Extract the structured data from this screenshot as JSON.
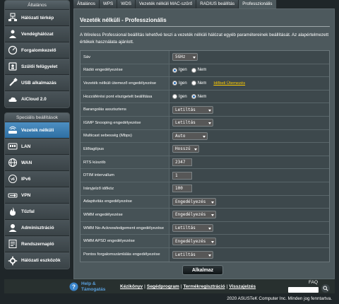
{
  "sidebar": {
    "general_title": "Általános",
    "general_items": [
      {
        "label": "Hálózati térkép",
        "icon": "network-map-icon"
      },
      {
        "label": "Vendéghálózat",
        "icon": "guest-network-icon"
      },
      {
        "label": "Forgalomkezelő",
        "icon": "traffic-manager-icon"
      },
      {
        "label": "Szülői felügyelet",
        "icon": "parental-control-icon"
      },
      {
        "label": "USB alkalmazás",
        "icon": "usb-icon"
      },
      {
        "label": "AiCloud 2.0",
        "icon": "cloud-icon"
      }
    ],
    "advanced_title": "Speciális beállítások",
    "advanced_items": [
      {
        "label": "Vezeték nélküli",
        "icon": "wireless-icon",
        "active": true
      },
      {
        "label": "LAN",
        "icon": "lan-icon"
      },
      {
        "label": "WAN",
        "icon": "wan-icon"
      },
      {
        "label": "IPv6",
        "icon": "ipv6-icon"
      },
      {
        "label": "VPN",
        "icon": "vpn-icon"
      },
      {
        "label": "Tűzfal",
        "icon": "firewall-icon"
      },
      {
        "label": "Adminisztráció",
        "icon": "administration-icon"
      },
      {
        "label": "Rendszernapló",
        "icon": "system-log-icon"
      },
      {
        "label": "Hálózati eszközök",
        "icon": "network-tools-icon"
      }
    ]
  },
  "tabs": [
    "Általános",
    "WPS",
    "WDS",
    "Vezeték nélküli MAC-szűrő",
    "RADIUS beállítás",
    "Professzionális"
  ],
  "active_tab": 5,
  "page": {
    "title": "Vezeték nélküli - Professzionális",
    "description": "A Wireless Professional beállítás lehetővé teszi a vezeték nélküli hálózat egyéb paramétereinek beállítását. Az alapértelmezett értékek használata ajánlott."
  },
  "settings": {
    "band": {
      "label": "Sáv",
      "value": "5GHz"
    },
    "radio_enable": {
      "label": "Rádió engedélyezése",
      "yes": "Igen",
      "no": "Nem",
      "selected": "yes"
    },
    "scheduler": {
      "label": "Vezeték nélküli ütemező engedélyezése",
      "yes": "Igen",
      "no": "Nem",
      "selected": "yes",
      "link": "Időbeli Ütemezés"
    },
    "ap_isolation": {
      "label": "Hozzáférési pont elszigetelt beállítása",
      "yes": "Igen",
      "no": "Nem",
      "selected": "no"
    },
    "roaming": {
      "label": "Barangolás asszisztens",
      "value": "Letiltás"
    },
    "igmp": {
      "label": "IGMP Snooping engedélyezése",
      "value": "Letiltás"
    },
    "multicast": {
      "label": "Multicast sebesség (Mbps)",
      "value": "Auto"
    },
    "preamble": {
      "label": "Előtagtípus",
      "value": "Hosszú"
    },
    "rts": {
      "label": "RTS küszöb",
      "value": "2347"
    },
    "dtim": {
      "label": "DTIM intervallum",
      "value": "1"
    },
    "beacon": {
      "label": "Irányjelző időköz",
      "value": "100"
    },
    "adaptivity": {
      "label": "Adaptivitás engedélyezése",
      "value": "Engedélyezés"
    },
    "wmm": {
      "label": "WMM engedélyezése",
      "value": "Engedélyezés"
    },
    "wmm_noack": {
      "label": "WMM No-Acknowledgement engedélyezése",
      "value": "Letiltás"
    },
    "wmm_apsd": {
      "label": "WMM APSD engedélyezése",
      "value": "Engedélyezés"
    },
    "airtime": {
      "label": "Pontos forgalomszámlálás engedélyezése",
      "value": "Letiltás"
    }
  },
  "apply_label": "Alkalmaz",
  "footer": {
    "help_label": "Help & Támogatás",
    "links": [
      "Kézikönyv",
      "Segédprogram",
      "Termékregisztráció",
      "Visszajelzés"
    ],
    "faq_label": "FAQ",
    "copyright": "2020 ASUSTeK Computer Inc. Minden jog fenntartva."
  },
  "colors": {
    "accent": "#2e6fa3",
    "panel": "#4d595d",
    "link": "#ffcc00"
  }
}
